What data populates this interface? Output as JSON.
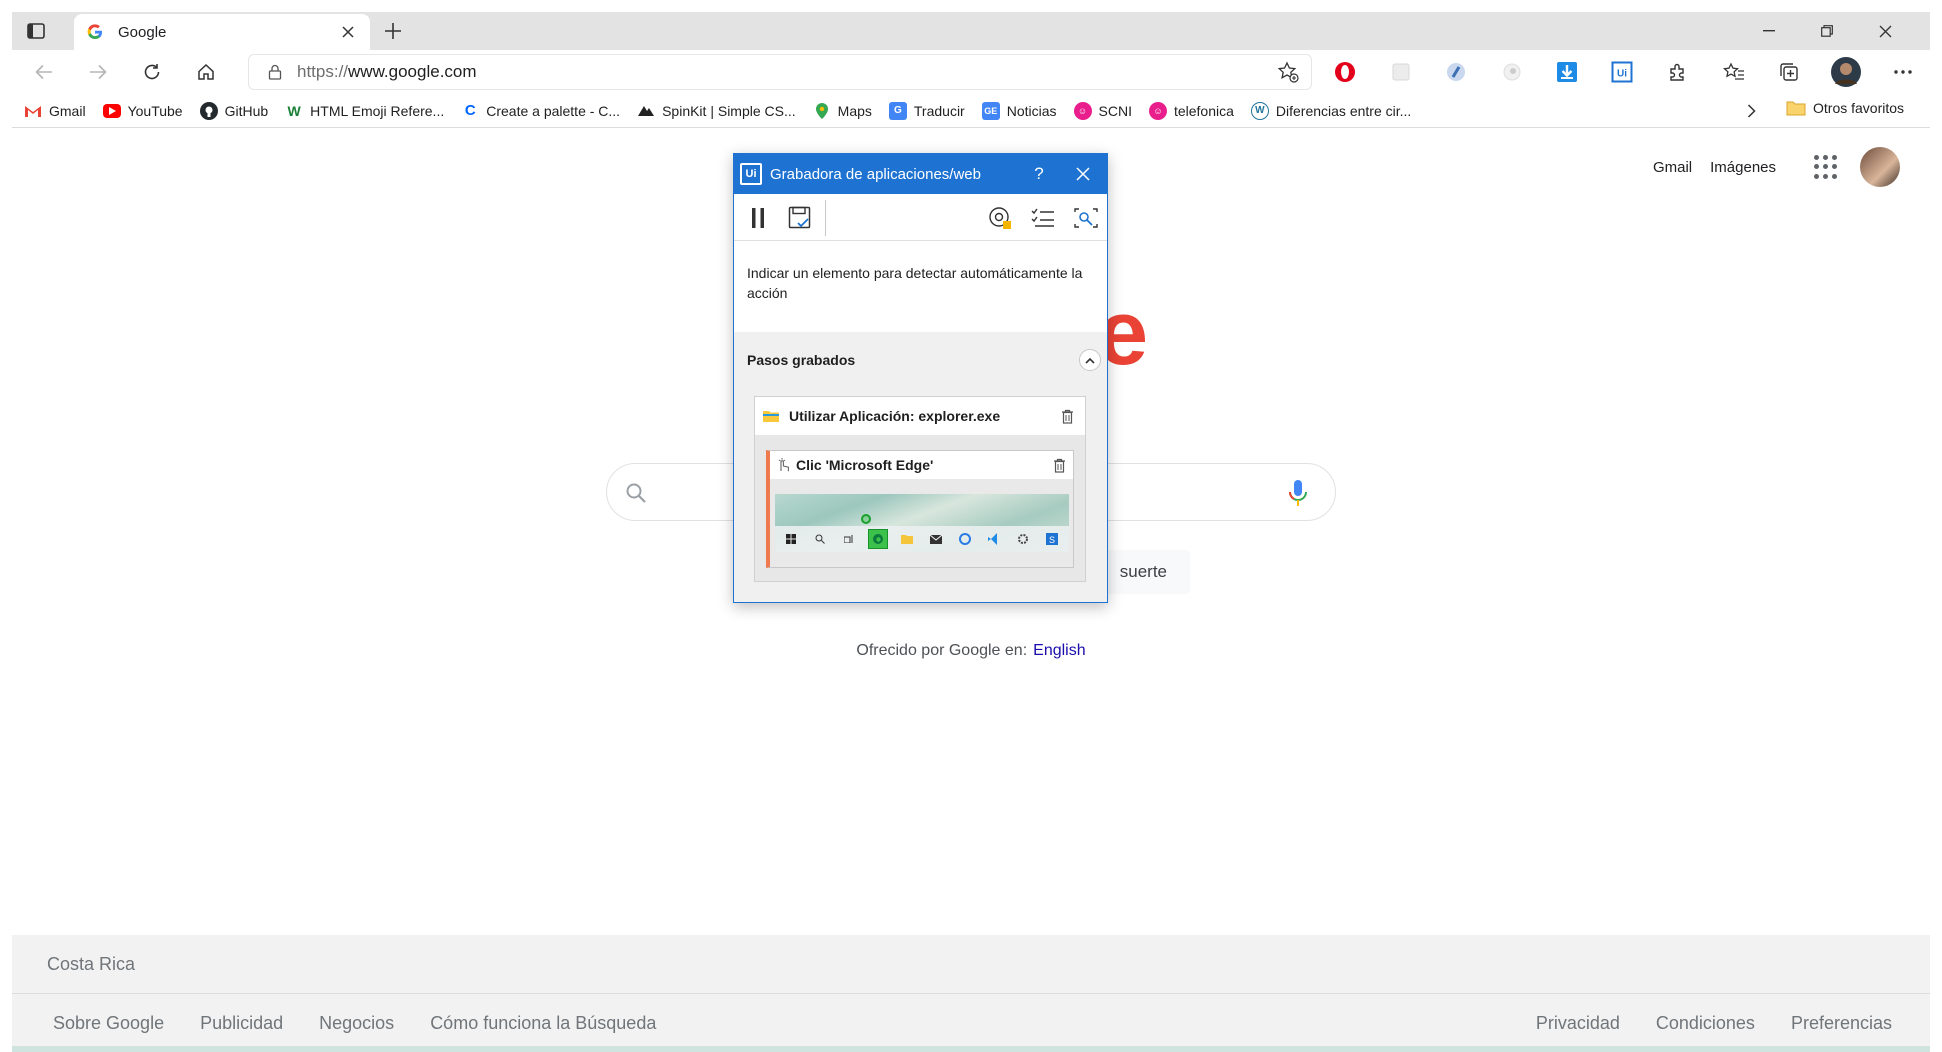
{
  "browser": {
    "tab": {
      "title": "Google"
    },
    "address": {
      "protocol": "https://",
      "host": "www.google.com"
    },
    "bookmarks": [
      {
        "label": "Gmail",
        "icon": "gmail-icon",
        "color": "#ea4335"
      },
      {
        "label": "YouTube",
        "icon": "youtube-icon",
        "color": "#ff0000"
      },
      {
        "label": "GitHub",
        "icon": "github-icon",
        "color": "#24292e"
      },
      {
        "label": "HTML Emoji Refere...",
        "icon": "w-icon",
        "color": "#1a7f37"
      },
      {
        "label": "Create a palette - C...",
        "icon": "coolors-icon",
        "color": "#0066ff"
      },
      {
        "label": "SpinKit | Simple CS...",
        "icon": "spinkit-icon",
        "color": "#222222"
      },
      {
        "label": "Maps",
        "icon": "maps-icon",
        "color": "#34a853"
      },
      {
        "label": "Traducir",
        "icon": "translate-icon",
        "color": "#4285f4"
      },
      {
        "label": "Noticias",
        "icon": "news-icon",
        "color": "#4285f4"
      },
      {
        "label": "SCNI",
        "icon": "scni-icon",
        "color": "#e91e8c"
      },
      {
        "label": "telefonica",
        "icon": "telefonica-icon",
        "color": "#e91e8c"
      },
      {
        "label": "Diferencias entre cir...",
        "icon": "wordpress-icon",
        "color": "#21759b"
      }
    ],
    "other_favorites": "Otros favoritos"
  },
  "google": {
    "top_links": {
      "gmail": "Gmail",
      "images": "Imágenes"
    },
    "logo_visible_letter": "e",
    "lucky_partial": "suerte",
    "offered_by": "Ofrecido por Google en:",
    "offered_lang": "English",
    "footer": {
      "country": "Costa Rica",
      "left_links": [
        "Sobre Google",
        "Publicidad",
        "Negocios",
        "Cómo funciona la Búsqueda"
      ],
      "right_links": [
        "Privacidad",
        "Condiciones",
        "Preferencias"
      ]
    }
  },
  "recorder": {
    "title": "Grabadora de aplicaciones/web",
    "logo": "Ui",
    "help": "?",
    "hint": "Indicar un elemento para detectar automáticamente la acción",
    "steps_header": "Pasos grabados",
    "step_app": "Utilizar Aplicación: explorer.exe",
    "step_click": "Clic 'Microsoft Edge'"
  },
  "colors": {
    "recorder_blue": "#1e73d2",
    "step_accent": "#f07a50",
    "google_red": "#ea4335",
    "link_blue": "#1a0dab"
  }
}
